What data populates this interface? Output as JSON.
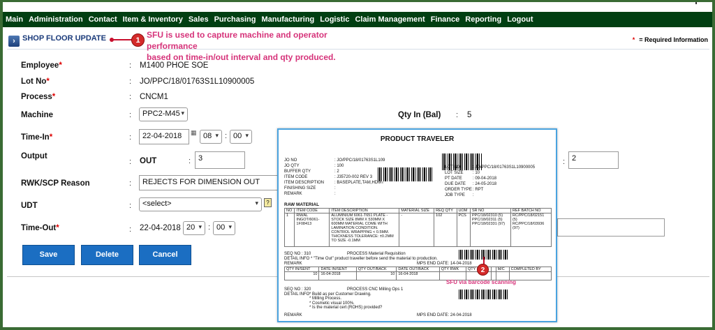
{
  "menu": [
    "Main",
    "Administration",
    "Contact",
    "Item & Inventory",
    "Sales",
    "Purchasing",
    "Manufacturing",
    "Logistic",
    "Claim Management",
    "Finance",
    "Reporting",
    "Logout"
  ],
  "header": {
    "title": "SHOP FLOOR UPDATE",
    "callout_number": "1",
    "callout_line1": "SFU is used to capture machine and operator performance",
    "callout_line2": "based on time-in/out interval and qty produced.",
    "required_star": "*",
    "required_text": "= Required Information"
  },
  "form": {
    "employee_label": "Employee",
    "employee_value": "M1400 PHOE SOE",
    "lot_label": "Lot No",
    "lot_value": "JO/PPC/18/01763S1L10900005",
    "process_label": "Process",
    "process_value": "CNCM1",
    "machine_label": "Machine",
    "machine_value": "PPC2-M45",
    "qty_in_label": "Qty In (Bal)",
    "qty_in_value": "5",
    "timein_label": "Time-In",
    "timein_date": "22-04-2018",
    "timein_hour": "08",
    "timein_min": "00",
    "output_label": "Output",
    "out_label": "OUT",
    "out_value": "3",
    "right_value": "2",
    "rwk_label": "RWK/SCP Reason",
    "rwk_value": "REJECTS FOR DIMENSION OUT",
    "udt_label": "UDT",
    "udt_value": "<select>",
    "timeout_label": "Time-Out",
    "timeout_date": "22-04-2018",
    "timeout_hour": "20",
    "timeout_min": "00",
    "colon": ":",
    "star": "*"
  },
  "buttons": {
    "save": "Save",
    "delete": "Delete",
    "cancel": "Cancel"
  },
  "traveler": {
    "title": "PRODUCT TRAVELER",
    "jo_no_l": "JO NO",
    "jo_no_v": ": JO/PPC/18/01763S1L109",
    "jo_qty_l": "JO QTY",
    "jo_qty_v": ": 100",
    "buffer_l": "BUFFER QTY",
    "buffer_v": ": 2",
    "item_code_l": "ITEM CODE",
    "item_code_v": ": J35720-002 REV 3",
    "item_desc_l": "ITEM DESCRIPTION",
    "item_desc_v": ": BASEPLATE,TAM,HDMT",
    "finish_l": "FINISHING SIZE",
    "finish_v": ":",
    "remark_l": "REMARK",
    "remark_v": ":",
    "lot_no_l": "LOT NO",
    "lot_no_v": ": JO/PPC/18/01763S1L10900005",
    "lot_size_l": "LOT SIZE",
    "lot_size_v": ": 10",
    "pt_date_l": "PT DATE",
    "pt_date_v": ": 09-04-2018",
    "due_l": "DUE DATE",
    "due_v": ": 24-05-2018",
    "order_l": "ORDER TYPE",
    "order_v": ": RPT",
    "job_l": "JOB TYPE",
    "job_v": ":",
    "raw_material": "RAW MATERIAL",
    "rm_headers": [
      "NO",
      "ITEM CODE",
      "ITEM DESCRIPTION",
      "MATERIAL SIZE",
      "REQ QTY",
      "UOM",
      "SR NO",
      "REF BATCH NO"
    ],
    "rm_row": [
      "1",
      "RM/AL INGOT/6061-1F08413",
      "ALUMINIUM 6061-T651 PLATE - STOCK SIZE 8MM X 530MM X 600MM MATERIAL COME WITH LAMINATION CONDITION. CONTROL WRAPPING < 0.5MM. THICKNESS TOLERANCE: ±0.2MM TO SIZE -0.1MM",
      "-",
      "102",
      "PCS",
      "PPC/18/02310 (5) PPC/18/02311 (5) PPC/18/02331 (97)",
      "RC/PPC/18/02151 (5) RC/PPC/18/03936 (97)"
    ],
    "seq1": "SEQ NO    : 310",
    "process1": "PROCESS    Material Requisition",
    "detail1": "DETAIL INFO  * \"Time Out\" product traveller before send the material to production.",
    "remark1": "REMARK",
    "mps1": "MPS END DATE: 14-04-2018",
    "op_headers": [
      "QTY IN/SENT",
      "DATE IN/SENT",
      "QTY OUT/BACK",
      "DATE OUT/BACK",
      "QTY RWK",
      "QTY SCP",
      "",
      "M/C",
      "COMPLETED BY"
    ],
    "op_row": [
      "10",
      "16-04-2018",
      "10",
      "16-04-2018",
      "",
      "",
      "",
      "",
      ""
    ],
    "scan_number": "2",
    "scan_label": "SFU via barcode scanning",
    "seq2": "SEQ NO    : 320",
    "process2": "PROCESS    CNC Milling Ops 1",
    "detail2_l": "DETAIL INFO",
    "detail2_a": "* Build as per Customer Drawing.",
    "detail2_b": "* Milling Process.",
    "detail2_c": "* Cosmetic visual 100%.",
    "detail2_d": "* Is the material cert (ROHS) provided?",
    "remark2": "REMARK",
    "mps2": "MPS END DATE: 24-04-2018"
  },
  "colors": {
    "menu_bg": "#013f12",
    "frame": "#3a6b34",
    "button": "#1b6ec2",
    "callout": "#d6337a",
    "badge": "#d42a2a"
  }
}
